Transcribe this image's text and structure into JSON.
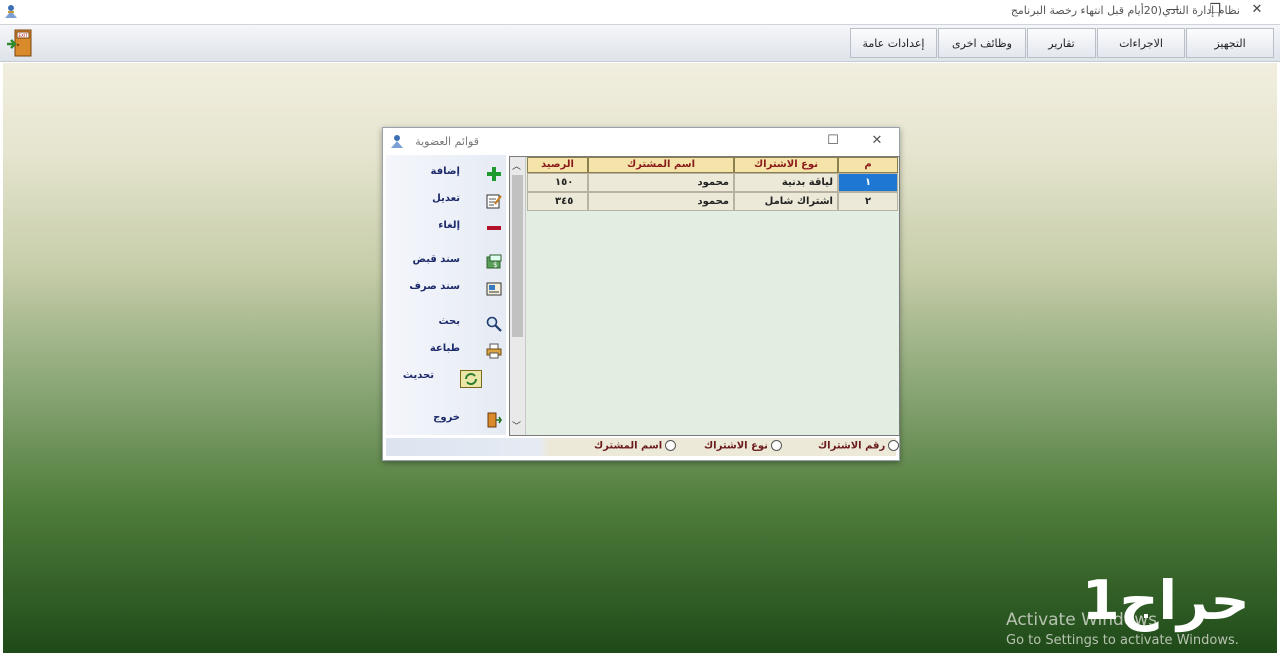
{
  "window": {
    "title": "نظام إدارة النادي(20أيام قبل انتهاء رخصة البرنامج",
    "minimize": "—",
    "restore": "❐",
    "close": "✕"
  },
  "menu": {
    "items": [
      {
        "label": "التجهيز"
      },
      {
        "label": "الاجراءات"
      },
      {
        "label": "تقارير"
      },
      {
        "label": "وظائف اخرى"
      },
      {
        "label": "إعدادات عامة"
      }
    ]
  },
  "dialog": {
    "title": "قوائم العضوية",
    "maximize": "☐",
    "close": "✕",
    "side_actions": [
      {
        "label": "إضافة",
        "icon": "plus-icon"
      },
      {
        "label": "تعديل",
        "icon": "edit-icon"
      },
      {
        "label": "إلغاء",
        "icon": "minus-icon"
      },
      {
        "label": "سند قبض",
        "icon": "receipt-icon"
      },
      {
        "label": "سند صرف",
        "icon": "voucher-icon"
      },
      {
        "label": "بحث",
        "icon": "magnifier-icon"
      },
      {
        "label": "طباعة",
        "icon": "printer-icon"
      },
      {
        "label": "تحديث",
        "icon": "refresh-icon"
      },
      {
        "label": "خروج",
        "icon": "exit-door-icon"
      }
    ],
    "table": {
      "headers": {
        "num": "م",
        "type": "نوع الاشتراك",
        "name": "اسم المشترك",
        "balance": "الرصيد"
      },
      "rows": [
        {
          "num": "١",
          "type": "لياقة بدنية",
          "name": "محمود",
          "balance": "١٥٠"
        },
        {
          "num": "٢",
          "type": "اشتراك شامل",
          "name": "محمود",
          "balance": "٣٤٥"
        }
      ]
    },
    "radios": [
      {
        "label": "رقم الاشتراك"
      },
      {
        "label": "نوع الاشتراك"
      },
      {
        "label": "اسم المشترك"
      }
    ]
  },
  "desktop": {
    "watermark_line1": "Activate Windows",
    "watermark_line2": "Go to Settings to activate Windows.",
    "brand": "حراج1"
  }
}
